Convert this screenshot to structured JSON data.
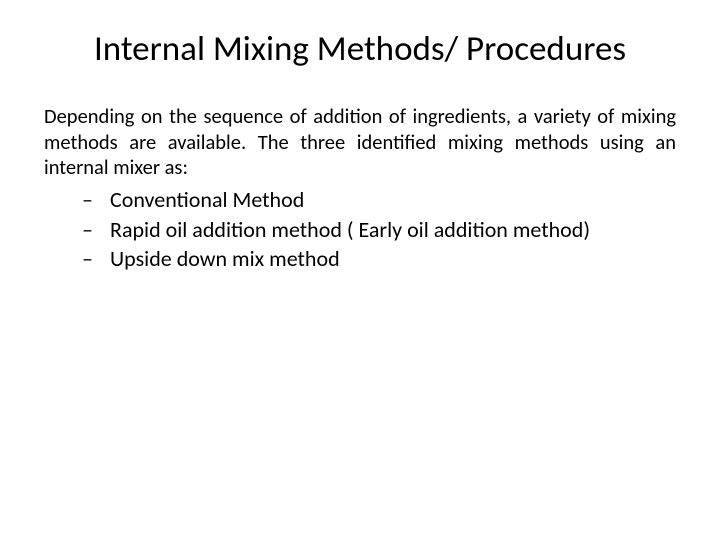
{
  "title": "Internal Mixing Methods/ Procedures",
  "paragraph": "Depending on the sequence of addition of ingredients, a variety of mixing methods are available. The three identified mixing methods using an internal mixer as:",
  "bullets": [
    "Conventional Method",
    "Rapid oil addition method ( Early oil addition method)",
    "Upside down mix method"
  ]
}
